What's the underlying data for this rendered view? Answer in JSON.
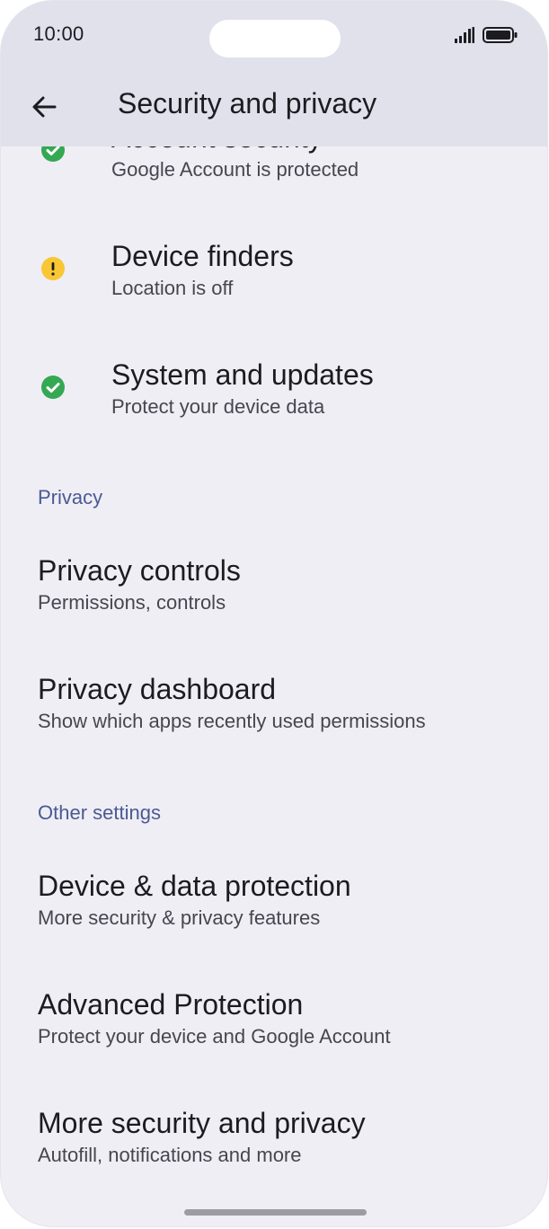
{
  "status_bar": {
    "time": "10:00"
  },
  "app_bar": {
    "title": "Security and privacy",
    "back_icon": "arrow-back-icon"
  },
  "status_items": [
    {
      "title": "Account security",
      "subtitle": "Google Account is protected",
      "status": "ok",
      "icon": "check-circle-icon",
      "color": "#34a853"
    },
    {
      "title": "Device finders",
      "subtitle": "Location is off",
      "status": "warning",
      "icon": "warning-circle-icon",
      "color": "#f9c634"
    },
    {
      "title": "System and updates",
      "subtitle": "Protect your device data",
      "status": "ok",
      "icon": "check-circle-icon",
      "color": "#34a853"
    }
  ],
  "privacy_section": {
    "header": "Privacy",
    "items": [
      {
        "title": "Privacy controls",
        "subtitle": "Permissions, controls"
      },
      {
        "title": "Privacy dashboard",
        "subtitle": "Show which apps recently used permissions"
      }
    ]
  },
  "other_section": {
    "header": "Other settings",
    "items": [
      {
        "title": "Device & data protection",
        "subtitle": "More security & privacy features"
      },
      {
        "title": "Advanced Protection",
        "subtitle": "Protect your device and Google Account"
      },
      {
        "title": "More security and privacy",
        "subtitle": "Autofill, notifications and more"
      }
    ]
  },
  "colors": {
    "background": "#efeef5",
    "app_bar": "#e1e1ec",
    "section_header": "#4b5a92",
    "ok": "#34a853",
    "warning": "#f9c634"
  }
}
